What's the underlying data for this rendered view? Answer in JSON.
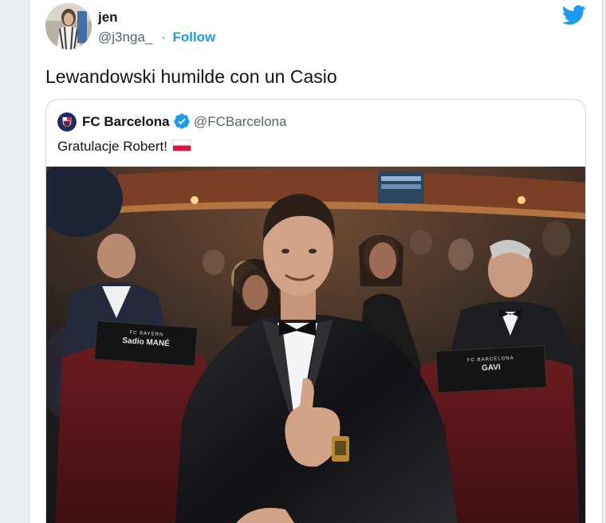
{
  "author": {
    "name": "jen",
    "handle": "@j3nga_",
    "separator": "·",
    "follow_label": "Follow"
  },
  "tweet": {
    "text": "Lewandowski humilde con un Casio"
  },
  "quoted": {
    "name": "FC Barcelona",
    "handle": "@FCBarcelona",
    "text": "Gratulacje Robert!",
    "photo": {
      "seat_label_1_small": "FC BAYERN",
      "seat_label_1": "Sadio MANÉ",
      "seat_label_2_small": "FC BARCELONA",
      "seat_label_2": "GAVI"
    }
  },
  "colors": {
    "accent": "#1d9bf0",
    "muted": "#536471"
  },
  "icons": {
    "brand": "twitter-bird-icon",
    "verified": "verified-badge-icon",
    "flag": "poland-flag-icon"
  }
}
